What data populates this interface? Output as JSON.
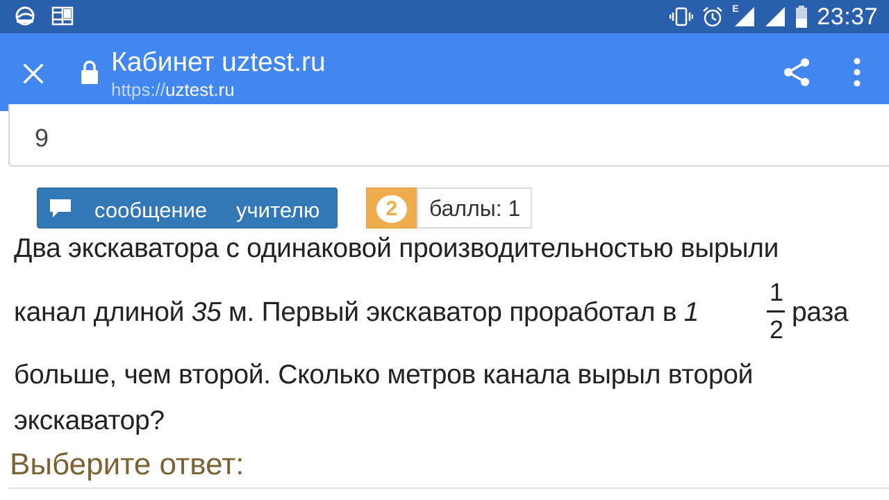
{
  "status_bar": {
    "time": "23:37",
    "network_label": "E",
    "icons": [
      "app-notification-icon",
      "image-notification-icon",
      "vibrate-icon",
      "alarm-icon",
      "signal-icon",
      "signal-icon-2",
      "battery-icon"
    ]
  },
  "toolbar": {
    "title": "Кабинет uztest.ru",
    "url_scheme": "https://",
    "url_host": "uztest.ru",
    "icons": [
      "close-icon",
      "lock-icon",
      "share-icon",
      "more-vert-icon"
    ],
    "color": "#4286f0"
  },
  "answer_field": {
    "value": "9"
  },
  "message_button": {
    "word1": "сообщение",
    "word2": "учителю",
    "color": "#3278b6"
  },
  "question": {
    "number": "2",
    "points": "баллы: 1",
    "number_color": "#f0ad4e",
    "line1": "Два экскаватора с одинаковой производительностью вырыли",
    "line2_prefix": "канал длиной ",
    "line2_length": "35",
    "line2_middle": " м. Первый экскаватор проработал в ",
    "line2_whole": "1",
    "frac_num": "1",
    "frac_den": "2",
    "line2_suffix": "раза",
    "line3": "больше, чем второй. Сколько метров канала вырыл второй",
    "line4": "экскаватор?"
  },
  "answer_section": {
    "label": "Выберите ответ:"
  }
}
